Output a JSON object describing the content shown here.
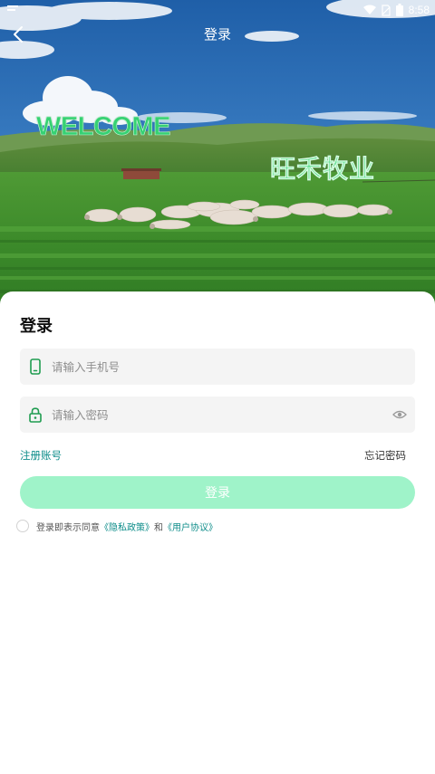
{
  "status_bar": {
    "time": "8:58",
    "icons": [
      "notification-icon",
      "wifi-icon",
      "no-sim-icon",
      "battery-icon"
    ]
  },
  "nav": {
    "title": "登录",
    "back_icon": "chevron-left-icon"
  },
  "hero": {
    "welcome": "WELCOME",
    "brand": "旺禾牧业"
  },
  "form": {
    "title": "登录",
    "phone": {
      "placeholder": "请输入手机号",
      "value": "",
      "icon": "phone-icon"
    },
    "password": {
      "placeholder": "请输入密码",
      "value": "",
      "icon": "lock-icon",
      "toggle_icon": "eye-icon"
    },
    "register_link": "注册账号",
    "forgot_link": "忘记密码",
    "submit_label": "登录"
  },
  "agreement": {
    "checked": false,
    "prefix": "登录即表示同意",
    "privacy_policy": "《隐私政策》",
    "conjunction": "和",
    "user_agreement": "《用户协议》"
  },
  "colors": {
    "accent": "#0e8d8a",
    "button_disabled": "#9ff3c9",
    "icon_green": "#1f9c50",
    "field_background": "#f4f4f4"
  }
}
